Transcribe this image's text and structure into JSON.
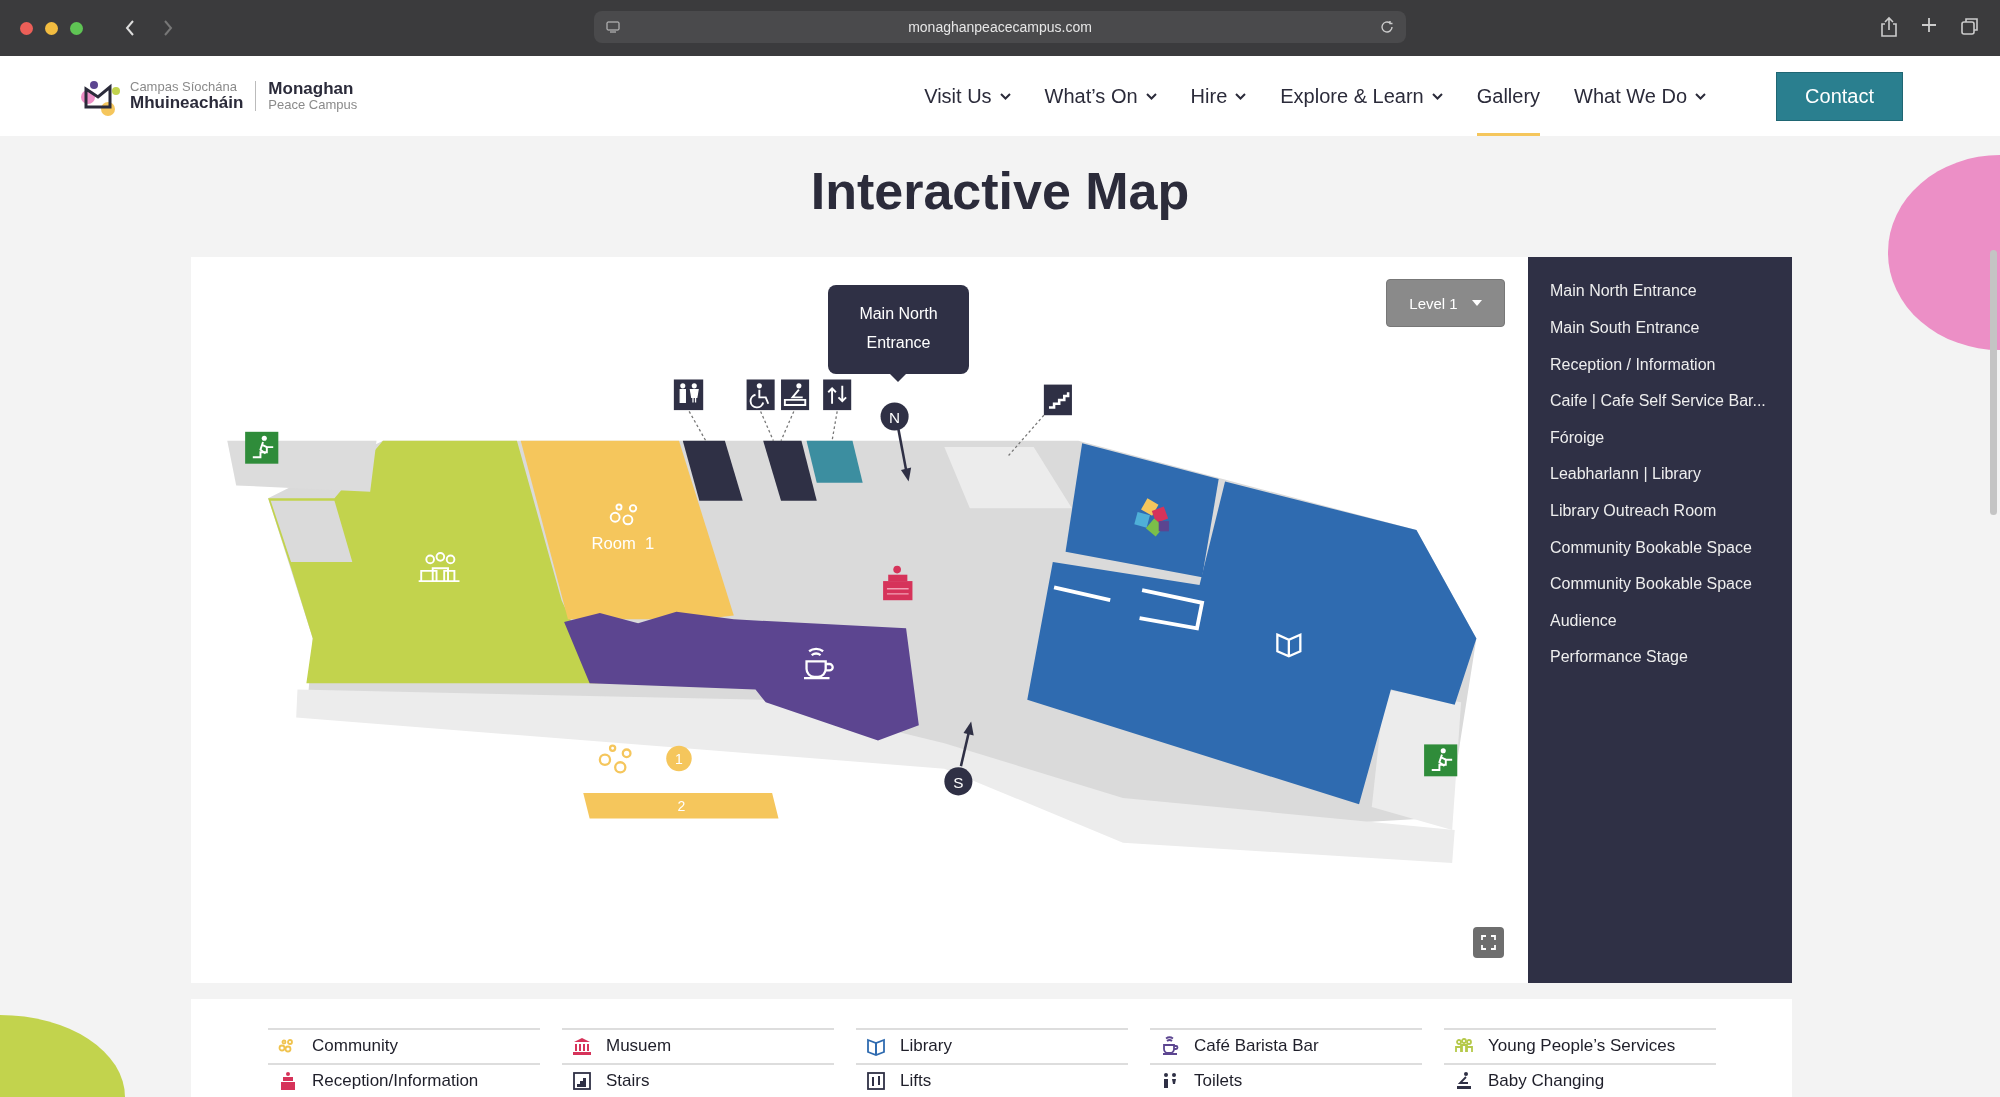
{
  "browser": {
    "url": "monaghanpeacecampus.com"
  },
  "header": {
    "logo": {
      "irish_top": "Campas Síochána",
      "irish_bottom": "Mhuineacháin",
      "english_top": "Monaghan",
      "english_bottom": "Peace Campus"
    },
    "nav": [
      {
        "label": "Visit Us",
        "dropdown": true,
        "selected": false
      },
      {
        "label": "What’s On",
        "dropdown": true,
        "selected": false
      },
      {
        "label": "Hire",
        "dropdown": true,
        "selected": false
      },
      {
        "label": "Explore & Learn",
        "dropdown": true,
        "selected": false
      },
      {
        "label": "Gallery",
        "dropdown": false,
        "selected": true
      },
      {
        "label": "What We Do",
        "dropdown": true,
        "selected": false
      }
    ],
    "contact_button": "Contact"
  },
  "title": "Interactive Map",
  "map": {
    "level_selector": "Level 1",
    "tooltip": "Main North Entrance",
    "room_label": "Room  1",
    "north_marker": "N",
    "south_marker": "S",
    "badge": "1",
    "bar_label": "2"
  },
  "locations": [
    "Main North Entrance",
    "Main South Entrance",
    "Reception / Information",
    "Caife | Cafe Self Service Bar...",
    "Fóroige",
    "Leabharlann | Library",
    "Library Outreach Room",
    "Community Bookable Space",
    "Community Bookable Space",
    "Audience",
    "Performance Stage"
  ],
  "legend": [
    {
      "label": "Community",
      "color": "#f0c34e"
    },
    {
      "label": "Musuem",
      "color": "#d6335a"
    },
    {
      "label": "Library",
      "color": "#2f6bb0"
    },
    {
      "label": "Café Barista Bar",
      "color": "#5c4590"
    },
    {
      "label": "Young People’s Services",
      "color": "#b5c94a"
    },
    {
      "label": "Reception/Information",
      "color": "#d6335a"
    },
    {
      "label": "Stairs",
      "color": "#2f3045"
    },
    {
      "label": "Lifts",
      "color": "#2f3045"
    },
    {
      "label": "Toilets",
      "color": "#2f3045"
    },
    {
      "label": "Baby Changing",
      "color": "#2f3045"
    }
  ]
}
